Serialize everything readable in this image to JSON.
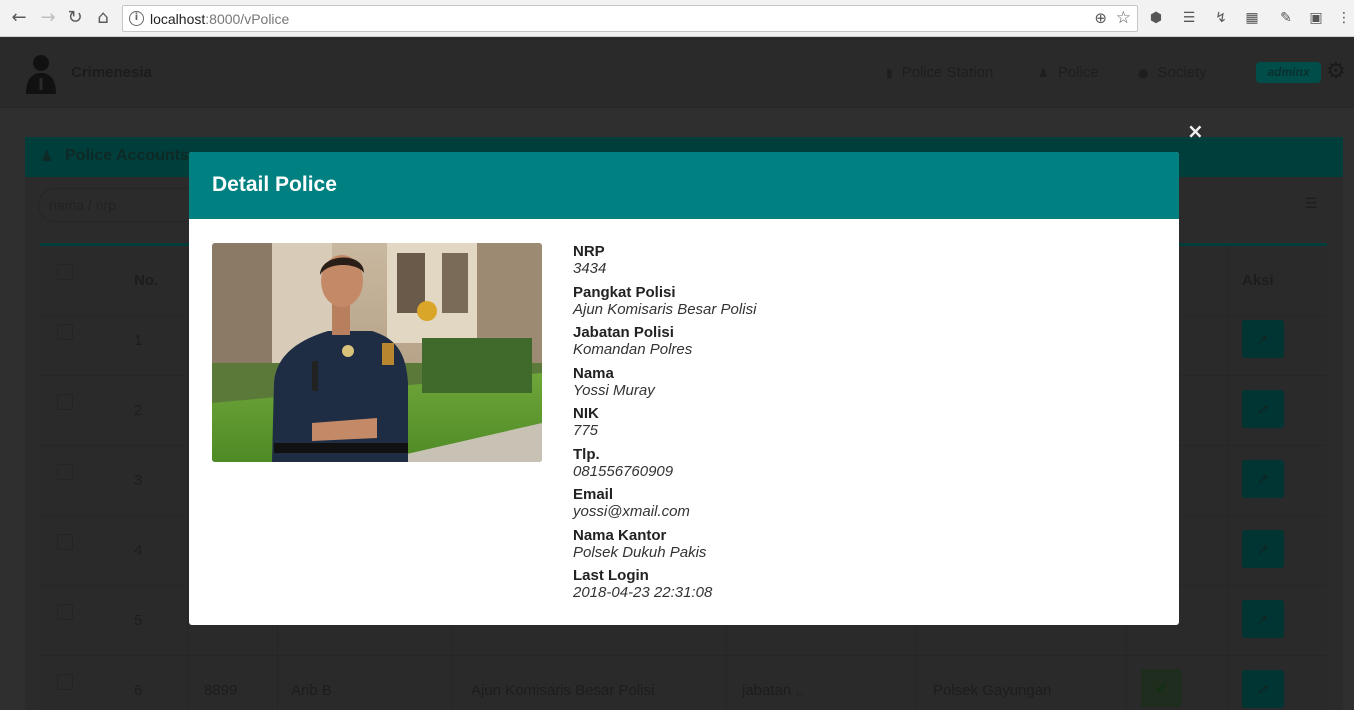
{
  "browser": {
    "url_host": "localhost",
    "url_rest": ":8000/vPolice"
  },
  "app": {
    "brand": "Crimenesia",
    "nav": [
      {
        "label": "Police Station",
        "icon": "building-icon"
      },
      {
        "label": "Police",
        "icon": "police-icon"
      },
      {
        "label": "Society",
        "icon": "user-icon"
      }
    ],
    "user_badge": "adminx"
  },
  "panel": {
    "title": "Police Accounts",
    "search_placeholder": "nama / nrp"
  },
  "table": {
    "headers": {
      "no": "No.",
      "aksi": "Aksi"
    },
    "rows": [
      {
        "no": "1"
      },
      {
        "no": "2"
      },
      {
        "no": "3"
      },
      {
        "no": "4"
      },
      {
        "no": "5"
      },
      {
        "no": "6",
        "nrp": "8899",
        "nama": "Arib B",
        "pangkat": "Ajun Komisaris Besar Polisi",
        "jabatan": "jabatan ..",
        "kantor": "Polsek Gayungan"
      }
    ]
  },
  "modal": {
    "title": "Detail Police",
    "close_icon": "×",
    "fields": [
      {
        "label": "NRP",
        "value": "3434"
      },
      {
        "label": "Pangkat Polisi",
        "value": "Ajun Komisaris Besar Polisi"
      },
      {
        "label": "Jabatan Polisi",
        "value": "Komandan Polres"
      },
      {
        "label": "Nama",
        "value": "Yossi Muray"
      },
      {
        "label": "NIK",
        "value": "775"
      },
      {
        "label": "Tlp.",
        "value": "081556760909"
      },
      {
        "label": "Email",
        "value": "yossi@xmail.com"
      },
      {
        "label": "Nama Kantor",
        "value": "Polsek Dukuh Pakis"
      },
      {
        "label": "Last Login",
        "value": "2018-04-23 22:31:08"
      }
    ]
  }
}
